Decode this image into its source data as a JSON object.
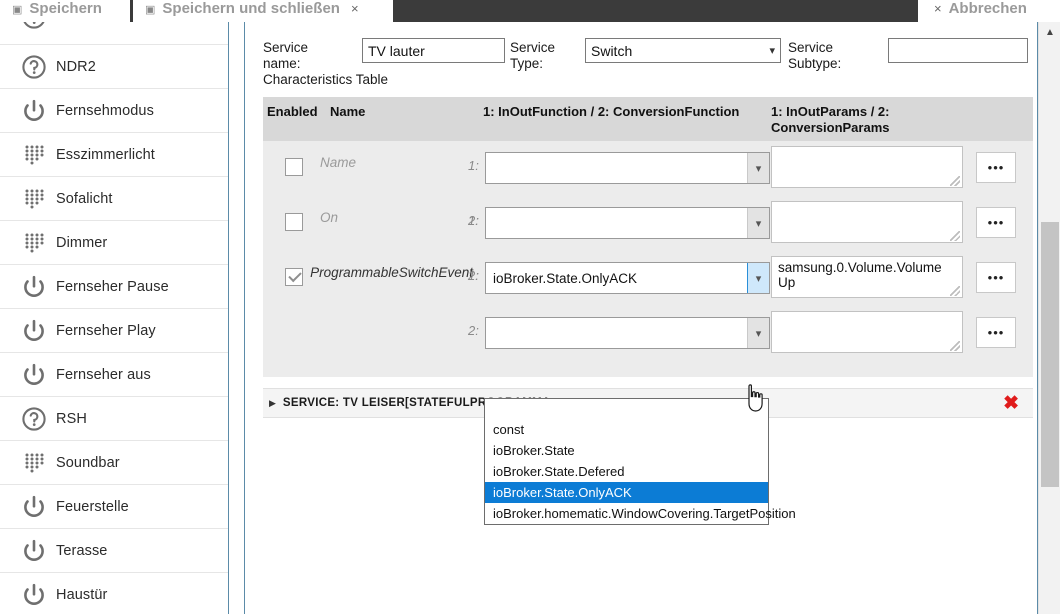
{
  "tabs": [
    {
      "label": "Speichern",
      "icon": "save-icon",
      "closable": false
    },
    {
      "label": "Speichern und schließen",
      "icon": "save-icon",
      "closable": true,
      "close": "×"
    },
    {
      "label": "Abbrechen",
      "icon": "cancel-icon",
      "close": "×"
    }
  ],
  "sidebar": {
    "items": [
      {
        "label": "",
        "icon": "help-circle-icon"
      },
      {
        "label": "NDR2",
        "icon": "help-circle-icon"
      },
      {
        "label": "Fernsehmodus",
        "icon": "power-icon"
      },
      {
        "label": "Esszimmerlicht",
        "icon": "keypad-dots-icon"
      },
      {
        "label": "Sofalicht",
        "icon": "keypad-dots-icon"
      },
      {
        "label": "Dimmer",
        "icon": "keypad-dots-icon"
      },
      {
        "label": "Fernseher Pause",
        "icon": "power-icon"
      },
      {
        "label": "Fernseher Play",
        "icon": "power-icon"
      },
      {
        "label": "Fernseher aus",
        "icon": "power-icon"
      },
      {
        "label": "RSH",
        "icon": "help-circle-icon"
      },
      {
        "label": "Soundbar",
        "icon": "keypad-dots-icon"
      },
      {
        "label": "Feuerstelle",
        "icon": "power-icon"
      },
      {
        "label": "Terasse",
        "icon": "power-icon"
      },
      {
        "label": "Haustür",
        "icon": "power-icon"
      }
    ]
  },
  "form": {
    "service_name_label": "Service name:",
    "characteristics_label": "Characteristics Table",
    "service_name_value": "TV lauter",
    "service_type_label": "Service Type:",
    "service_type_value": "Switch",
    "service_subtype_label": "Service Subtype:",
    "service_subtype_value": ""
  },
  "table": {
    "headers": {
      "enabled": "Enabled",
      "name": "Name",
      "function": "1: InOutFunction / 2: ConversionFunction",
      "params": "1: InOutParams / 2: ConversionParams"
    },
    "idx1": "1:",
    "idx2": "2:",
    "dots_label": "•••",
    "rows": [
      {
        "name": "Name",
        "checked": false,
        "active": false,
        "fn1": "",
        "fn2": "",
        "p1": "",
        "p2": ""
      },
      {
        "name": "On",
        "checked": false,
        "active": false,
        "fn1": "",
        "fn2": "",
        "p1": "",
        "p2": ""
      },
      {
        "name": "ProgrammableSwitchEvent",
        "checked": true,
        "active": true,
        "fn1": "ioBroker.State.OnlyACK",
        "fn2": "",
        "p1": "samsung.0.Volume.Volume Up",
        "p2": ""
      }
    ]
  },
  "dropdown": {
    "open": true,
    "selected": "ioBroker.State.OnlyACK",
    "options": [
      "const",
      "ioBroker.State",
      "ioBroker.State.Defered",
      "ioBroker.State.OnlyACK",
      "ioBroker.homematic.WindowCovering.TargetPosition"
    ]
  },
  "service_bar": {
    "triangle": "▶",
    "text": "SERVICE: TV LEISER[STATEFULPROGRAMMA",
    "delete": "✖"
  },
  "scrollbar": {
    "up_arrow": "▲"
  },
  "colors": {
    "accent": "#0c7cd5",
    "danger": "#e01b1b",
    "header_bg": "#d8d8d8",
    "row_bg": "#ececec",
    "divider": "#5b8ba8"
  }
}
